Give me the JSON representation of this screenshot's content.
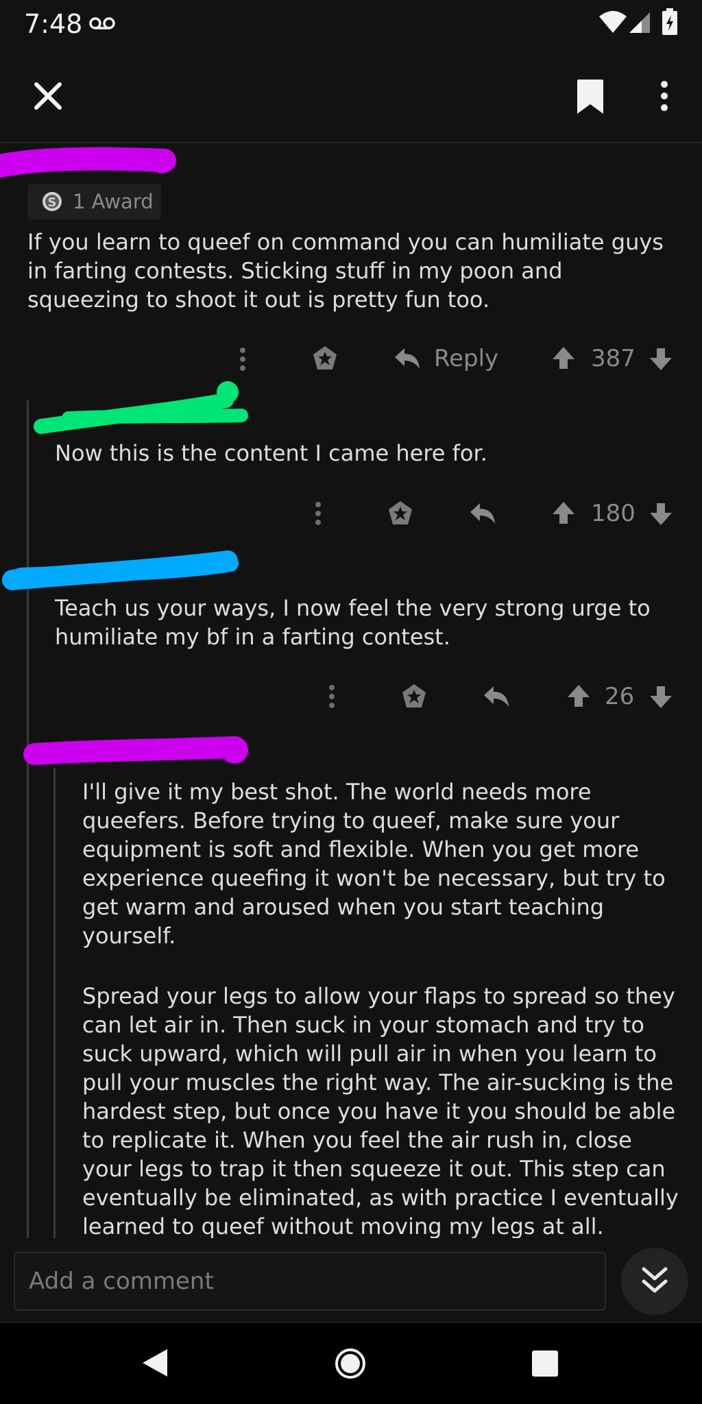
{
  "status_bar": {
    "time": "7:48",
    "icons": [
      "voicemail-icon",
      "wifi-icon",
      "signal-icon",
      "battery-charging-icon"
    ]
  },
  "top_bar": {
    "icons": [
      "close-icon",
      "bookmark-icon",
      "more-vertical-icon"
    ]
  },
  "colors": {
    "background": "#121212",
    "text": "#dedede",
    "muted": "#8a8a8a",
    "redact_magenta": "#cc00ee",
    "redact_green": "#00e676",
    "redact_blue": "#00aaff"
  },
  "comments": [
    {
      "award_label": "1 Award",
      "text_lines": [
        "If you learn to queef on command you can humiliate guys",
        "in farting contests. Sticking stuff in my poon and",
        "squeezing to shoot it out is pretty fun too."
      ],
      "reply_label": "Reply",
      "score": "387"
    },
    {
      "text_lines": [
        "Now this is the content I came here for."
      ],
      "score": "180"
    },
    {
      "text_lines": [
        "Teach us your ways, I now feel the very strong urge to",
        "humiliate my bf in a farting contest."
      ],
      "score": "26"
    },
    {
      "paragraphs": [
        [
          "I'll give it my best shot. The world needs more",
          "queefers. Before trying to queef, make sure your",
          "equipment is soft and flexible. When you get more",
          "experience queefing it won't be necessary, but try to",
          "get warm and aroused when you start teaching",
          "yourself."
        ],
        [
          "Spread your legs to allow your flaps to spread so they",
          "can let air in. Then suck in your stomach and try to",
          "suck upward, which will pull air in when you learn to",
          "pull your muscles the right way. The air-sucking is the",
          "hardest step, but once you have it you should be able",
          "to replicate it. When you feel the air rush in, close",
          "your legs to trap it then squeeze it out. This step can",
          "eventually be eliminated, as with practice I eventually",
          "learned to queef without moving my legs at all."
        ]
      ]
    }
  ],
  "comment_input": {
    "placeholder": "Add a comment"
  },
  "nav_bar": {
    "icons": [
      "back-triangle-icon",
      "home-circle-icon",
      "recents-square-icon"
    ]
  }
}
